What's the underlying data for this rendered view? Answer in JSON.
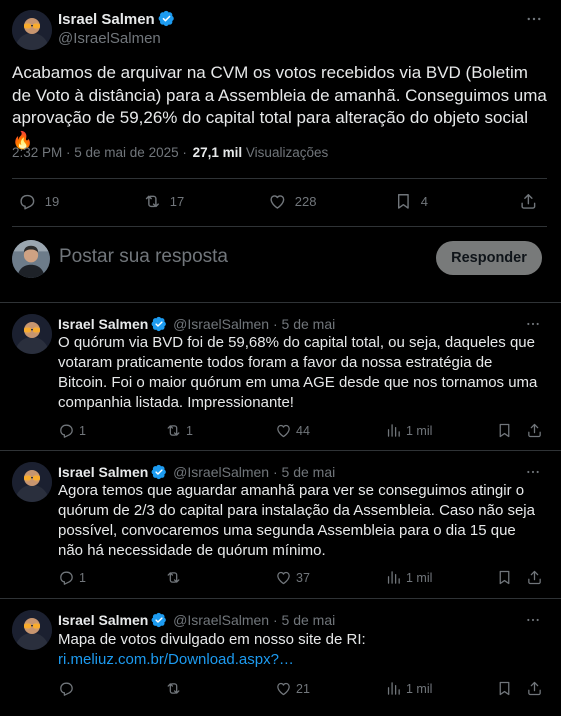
{
  "main_tweet": {
    "author_name": "Israel Salmen",
    "author_handle": "@IsraelSalmen",
    "text": "Acabamos de arquivar na CVM os votos recebidos via BVD (Boletim de Voto à distância) para a Assembleia de amanhã. Conseguimos uma aprovação de 59,26% do capital total para alteração do objeto social 🔥",
    "time": "2:32 PM · 5 de mai de 2025 ·",
    "views_count": "27,1 mil",
    "views_label": "Visualizações",
    "replies": "19",
    "retweets": "17",
    "likes": "228",
    "bookmarks": "4"
  },
  "composer": {
    "placeholder": "Postar sua resposta",
    "reply_button": "Responder"
  },
  "replies": [
    {
      "author_name": "Israel Salmen",
      "author_handle": "@IsraelSalmen",
      "date": "· 5 de mai",
      "text": "O quórum via BVD foi de 59,68% do capital total, ou seja, daqueles que votaram praticamente todos foram a favor da nossa estratégia de Bitcoin. Foi o maior quórum em uma AGE desde que nos tornamos uma companhia listada. Impressionante!",
      "replies": "1",
      "retweets": "1",
      "likes": "44",
      "views": "1 mil"
    },
    {
      "author_name": "Israel Salmen",
      "author_handle": "@IsraelSalmen",
      "date": "· 5 de mai",
      "text": "Agora temos que aguardar amanhã para ver se conseguimos atingir o quórum de 2/3 do capital para instalação da Assembleia. Caso não seja possível, convocaremos uma segunda Assembleia para o dia 15 que não há necessidade de quórum mínimo.",
      "replies": "1",
      "retweets": "",
      "likes": "37",
      "views": "1 mil"
    },
    {
      "author_name": "Israel Salmen",
      "author_handle": "@IsraelSalmen",
      "date": "· 5 de mai",
      "text": "Mapa de votos divulgado em nosso site de RI:",
      "link": "ri.meliuz.com.br/Download.aspx?…",
      "replies": "",
      "retweets": "",
      "likes": "21",
      "views": "1 mil"
    }
  ],
  "colors": {
    "background": "#000000",
    "text": "#e7e9ea",
    "muted": "#71767b",
    "verified": "#1d9bf0",
    "link": "#1d9bf0",
    "divider": "#2f3336"
  }
}
